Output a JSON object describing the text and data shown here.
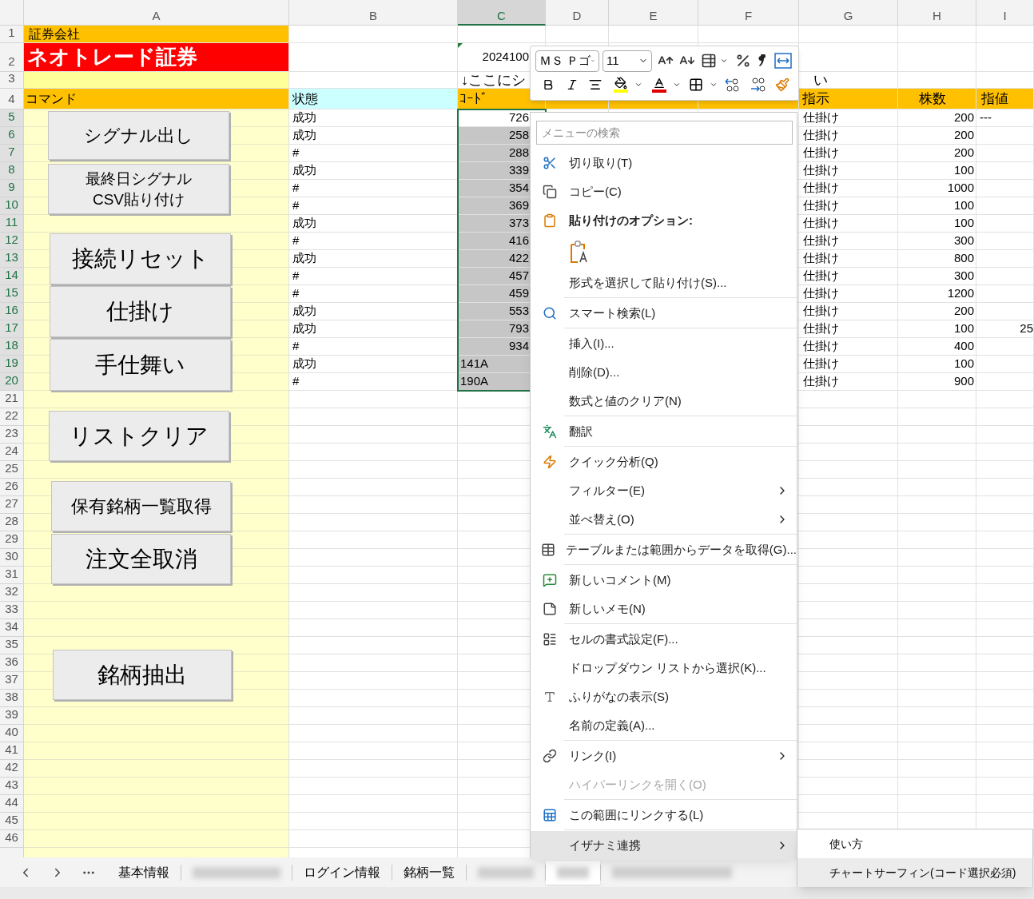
{
  "column_headers": [
    {
      "label": "A",
      "selected": false
    },
    {
      "label": "B",
      "selected": false
    },
    {
      "label": "C",
      "selected": true
    },
    {
      "label": "D",
      "selected": false
    },
    {
      "label": "E",
      "selected": false
    },
    {
      "label": "F",
      "selected": false
    },
    {
      "label": "G",
      "selected": false
    },
    {
      "label": "H",
      "selected": false
    },
    {
      "label": "I",
      "selected": false
    }
  ],
  "row_numbers": [
    {
      "label": "1",
      "selected": false
    },
    {
      "label": "2",
      "selected": false
    },
    {
      "label": "3",
      "selected": false
    },
    {
      "label": "4",
      "selected": false
    },
    {
      "label": "5",
      "selected": true
    },
    {
      "label": "6",
      "selected": true
    },
    {
      "label": "7",
      "selected": true
    },
    {
      "label": "8",
      "selected": true
    },
    {
      "label": "9",
      "selected": true
    },
    {
      "label": "10",
      "selected": true
    },
    {
      "label": "11",
      "selected": true
    },
    {
      "label": "12",
      "selected": true
    },
    {
      "label": "13",
      "selected": true
    },
    {
      "label": "14",
      "selected": true
    },
    {
      "label": "15",
      "selected": true
    },
    {
      "label": "16",
      "selected": true
    },
    {
      "label": "17",
      "selected": true
    },
    {
      "label": "18",
      "selected": true
    },
    {
      "label": "19",
      "selected": true
    },
    {
      "label": "20",
      "selected": true
    },
    {
      "label": "21",
      "selected": false
    },
    {
      "label": "22",
      "selected": false
    },
    {
      "label": "23",
      "selected": false
    },
    {
      "label": "24",
      "selected": false
    },
    {
      "label": "25",
      "selected": false
    },
    {
      "label": "26",
      "selected": false
    },
    {
      "label": "27",
      "selected": false
    },
    {
      "label": "28",
      "selected": false
    },
    {
      "label": "29",
      "selected": false
    },
    {
      "label": "30",
      "selected": false
    },
    {
      "label": "31",
      "selected": false
    },
    {
      "label": "32",
      "selected": false
    },
    {
      "label": "33",
      "selected": false
    },
    {
      "label": "34",
      "selected": false
    },
    {
      "label": "35",
      "selected": false
    },
    {
      "label": "36",
      "selected": false
    },
    {
      "label": "37",
      "selected": false
    },
    {
      "label": "38",
      "selected": false
    },
    {
      "label": "39",
      "selected": false
    },
    {
      "label": "40",
      "selected": false
    },
    {
      "label": "41",
      "selected": false
    },
    {
      "label": "42",
      "selected": false
    },
    {
      "label": "43",
      "selected": false
    },
    {
      "label": "44",
      "selected": false
    },
    {
      "label": "45",
      "selected": false
    },
    {
      "label": "46",
      "selected": false
    }
  ],
  "top_cells": {
    "a1": "証券会社",
    "a2": "ネオトレード証券",
    "c2": "2024100",
    "c3": "↓ここにシ",
    "g3": "い"
  },
  "header_row": {
    "command": "コマンド",
    "status": "状態",
    "code": "ｺｰﾄﾞ",
    "instruction": "指示",
    "shares": "株数",
    "limit": "指値"
  },
  "data_rows": [
    {
      "status": "成功",
      "code": {
        "text": "726",
        "kind": "number"
      },
      "shaded": false,
      "instruction": "仕掛け",
      "shares": "200",
      "limit": {
        "text": "---",
        "kind": "text"
      }
    },
    {
      "status": "成功",
      "code": {
        "text": "258",
        "kind": "number"
      },
      "shaded": true,
      "instruction": "仕掛け",
      "shares": "200"
    },
    {
      "status": "#",
      "code": {
        "text": "288",
        "kind": "number"
      },
      "shaded": true,
      "instruction": "仕掛け",
      "shares": "200"
    },
    {
      "status": "成功",
      "code": {
        "text": "339",
        "kind": "number"
      },
      "shaded": true,
      "instruction": "仕掛け",
      "shares": "100"
    },
    {
      "status": "#",
      "code": {
        "text": "354",
        "kind": "number"
      },
      "shaded": true,
      "instruction": "仕掛け",
      "shares": "1000"
    },
    {
      "status": "#",
      "code": {
        "text": "369",
        "kind": "number"
      },
      "shaded": true,
      "instruction": "仕掛け",
      "shares": "100"
    },
    {
      "status": "成功",
      "code": {
        "text": "373",
        "kind": "number"
      },
      "shaded": true,
      "instruction": "仕掛け",
      "shares": "100"
    },
    {
      "status": "#",
      "code": {
        "text": "416",
        "kind": "number"
      },
      "shaded": true,
      "instruction": "仕掛け",
      "shares": "300"
    },
    {
      "status": "成功",
      "code": {
        "text": "422",
        "kind": "number"
      },
      "shaded": true,
      "instruction": "仕掛け",
      "shares": "800"
    },
    {
      "status": "#",
      "code": {
        "text": "457",
        "kind": "number"
      },
      "shaded": true,
      "instruction": "仕掛け",
      "shares": "300"
    },
    {
      "status": "#",
      "code": {
        "text": "459",
        "kind": "number"
      },
      "shaded": true,
      "instruction": "仕掛け",
      "shares": "1200"
    },
    {
      "status": "成功",
      "code": {
        "text": "553",
        "kind": "number"
      },
      "shaded": true,
      "instruction": "仕掛け",
      "shares": "200"
    },
    {
      "status": "成功",
      "code": {
        "text": "793",
        "kind": "number"
      },
      "shaded": true,
      "instruction": "仕掛け",
      "shares": "100",
      "limit": {
        "text": "25",
        "kind": "number"
      }
    },
    {
      "status": "#",
      "code": {
        "text": "934",
        "kind": "number"
      },
      "shaded": true,
      "instruction": "仕掛け",
      "shares": "400"
    },
    {
      "status": "成功",
      "code": {
        "text": "141A",
        "kind": "text"
      },
      "shaded": true,
      "instruction": "仕掛け",
      "shares": "100"
    },
    {
      "status": "#",
      "code": {
        "text": "190A",
        "kind": "text"
      },
      "shaded": true,
      "instruction": "仕掛け",
      "shares": "900"
    }
  ],
  "command_buttons": [
    {
      "lines": [
        "シグナル出し"
      ]
    },
    {
      "lines": [
        "最終日シグナル",
        "CSV貼り付け"
      ]
    },
    {
      "lines": [
        "接続リセット"
      ]
    },
    {
      "lines": [
        "仕掛け"
      ]
    },
    {
      "lines": [
        "手仕舞い"
      ]
    },
    {
      "lines": [
        "リストクリア"
      ]
    },
    {
      "lines": [
        "保有銘柄一覧取得"
      ]
    },
    {
      "lines": [
        "注文全取消"
      ]
    },
    {
      "lines": [
        "銘柄抽出"
      ]
    }
  ],
  "mini_toolbar": {
    "font": "ＭＳ Ｐゴ",
    "size": "11"
  },
  "context_menu": {
    "search": {
      "placeholder": "メニューの検索"
    },
    "sections": [
      [
        {
          "kind": "item",
          "label": "切り取り(T)",
          "submenu": false,
          "disabled": false,
          "selected": false
        },
        {
          "kind": "item",
          "label": "コピー(C)",
          "submenu": false,
          "disabled": false,
          "selected": false
        },
        {
          "kind": "heading",
          "label": "貼り付けのオプション:",
          "submenu": false,
          "disabled": false,
          "selected": false
        },
        {
          "kind": "paste_icons"
        },
        {
          "kind": "item",
          "label": "形式を選択して貼り付け(S)...",
          "submenu": false,
          "disabled": false,
          "selected": false
        }
      ],
      [
        {
          "kind": "item",
          "label": "スマート検索(L)",
          "submenu": false,
          "disabled": false,
          "selected": false
        }
      ],
      [
        {
          "kind": "item",
          "label": "挿入(I)...",
          "submenu": false,
          "disabled": false,
          "selected": false
        },
        {
          "kind": "item",
          "label": "削除(D)...",
          "submenu": false,
          "disabled": false,
          "selected": false
        },
        {
          "kind": "item",
          "label": "数式と値のクリア(N)",
          "submenu": false,
          "disabled": false,
          "selected": false
        }
      ],
      [
        {
          "kind": "item",
          "label": "翻訳",
          "submenu": false,
          "disabled": false,
          "selected": false
        }
      ],
      [
        {
          "kind": "item",
          "label": "クイック分析(Q)",
          "submenu": false,
          "disabled": false,
          "selected": false
        },
        {
          "kind": "item",
          "label": "フィルター(E)",
          "submenu": true,
          "disabled": false,
          "selected": false
        },
        {
          "kind": "item",
          "label": "並べ替え(O)",
          "submenu": true,
          "disabled": false,
          "selected": false
        }
      ],
      [
        {
          "kind": "item",
          "label": "テーブルまたは範囲からデータを取得(G)...",
          "submenu": false,
          "disabled": false,
          "selected": false
        }
      ],
      [
        {
          "kind": "item",
          "label": "新しいコメント(M)",
          "submenu": false,
          "disabled": false,
          "selected": false
        },
        {
          "kind": "item",
          "label": "新しいメモ(N)",
          "submenu": false,
          "disabled": false,
          "selected": false
        }
      ],
      [
        {
          "kind": "item",
          "label": "セルの書式設定(F)...",
          "submenu": false,
          "disabled": false,
          "selected": false
        },
        {
          "kind": "item",
          "label": "ドロップダウン リストから選択(K)...",
          "submenu": false,
          "disabled": false,
          "selected": false
        },
        {
          "kind": "item",
          "label": "ふりがなの表示(S)",
          "submenu": false,
          "disabled": false,
          "selected": false
        },
        {
          "kind": "item",
          "label": "名前の定義(A)...",
          "submenu": false,
          "disabled": false,
          "selected": false
        }
      ],
      [
        {
          "kind": "item",
          "label": "リンク(I)",
          "submenu": true,
          "disabled": false,
          "selected": false
        },
        {
          "kind": "item",
          "label": "ハイパーリンクを開く(O)",
          "submenu": false,
          "disabled": true,
          "selected": false
        }
      ],
      [
        {
          "kind": "item",
          "label": "この範囲にリンクする(L)",
          "submenu": false,
          "disabled": false,
          "selected": false
        }
      ],
      [
        {
          "kind": "item",
          "label": "イザナミ連携",
          "submenu": true,
          "disabled": false,
          "selected": true
        }
      ]
    ]
  },
  "submenu": {
    "items": [
      {
        "label": "使い方",
        "selected": false
      },
      {
        "label": "チャートサーフィン(コード選択必須)",
        "selected": true
      }
    ]
  },
  "sheet_tabs": [
    {
      "kind": "text",
      "label": "基本情報",
      "selected": false
    },
    {
      "kind": "blurred",
      "selected": false
    },
    {
      "kind": "text",
      "label": "ログイン情報",
      "selected": false
    },
    {
      "kind": "text",
      "label": "銘柄一覧",
      "selected": false
    },
    {
      "kind": "blurred",
      "selected": false
    },
    {
      "kind": "blurred",
      "selected": true
    },
    {
      "kind": "blurred",
      "selected": false
    }
  ]
}
